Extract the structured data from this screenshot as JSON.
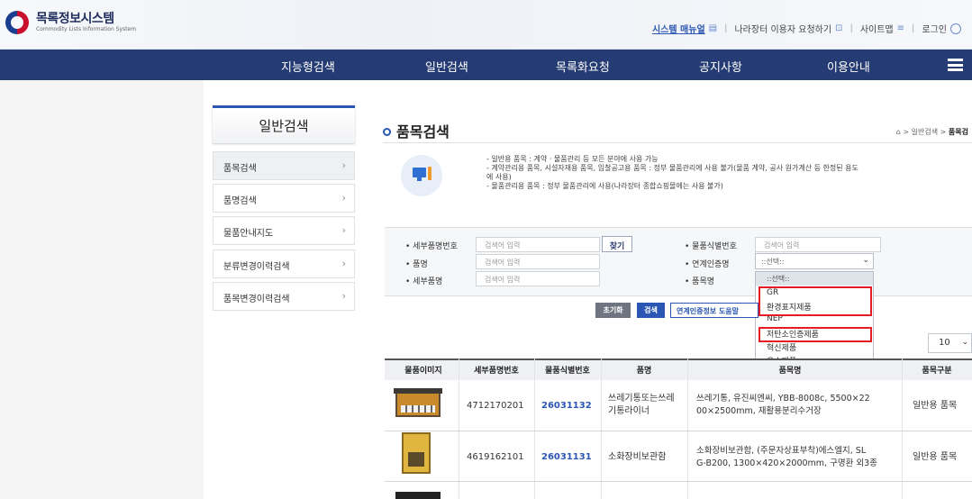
{
  "header": {
    "logo_title": "목록정보시스템",
    "logo_subtitle": "Commodity Lists Information System",
    "util_links": [
      "시스템 매뉴얼",
      "나라장터 이용자 요청하기",
      "사이트맵",
      "로그인"
    ]
  },
  "nav": [
    "지능형검색",
    "일반검색",
    "목록화요청",
    "공지사항",
    "이용안내"
  ],
  "sidebar": {
    "title": "일반검색",
    "items": [
      "품목검색",
      "품명검색",
      "물품안내지도",
      "분류변경이력검색",
      "품목변경이력검색"
    ]
  },
  "main": {
    "title": "품목검색",
    "breadcrumb": [
      "일반검색",
      "품목검"
    ],
    "info_lines": [
      "- 일반용 품목 : 계약 · 물품관리 등 모든 분야에 사용 가능",
      "- 계약관리용 품목, 시설자재용 품목, 입찰공고용 품목 : 정부 물품관리에 사용 불가(물품 계약, 공사 원가계산 등 한정된 용도",
      "에 사용)",
      "- 물품관리용 품목 : 정부 물품관리에 사용(나라장터 종합쇼핑몰에는 사용 불가)"
    ]
  },
  "form": {
    "labels": [
      "세부품명번호",
      "품명",
      "세부품명",
      "물품식별번호",
      "연계인증명",
      "품목명"
    ],
    "placeholder": "검색어 입력",
    "find_button": "찾기",
    "select_value": "::선택::",
    "dropdown_head": "::선택::",
    "dropdown_options": [
      "GR",
      "환경표지제품",
      "NEP",
      "저탄소인증제품",
      "혁신제품",
      "우수제품"
    ]
  },
  "buttons": {
    "reset": "초기화",
    "search": "검색",
    "help": "연계인증정보 도움말"
  },
  "page_size": "10",
  "table": {
    "headers": [
      "물품이미지",
      "세부품명번호",
      "물품식별번호",
      "품명",
      "품목명",
      "품목구분"
    ],
    "rows": [
      {
        "detail_no": "4712170201",
        "item_id": "26031132",
        "name": [
          "쓰레기통또는쓰레",
          "기통라이너"
        ],
        "desc": [
          "쓰레기통, 유진씨엔씨, YBB-8008c, 5500×22",
          "00×2500mm, 재활용분리수거장"
        ],
        "type": "일반용 품목"
      },
      {
        "detail_no": "4619162101",
        "item_id": "26031131",
        "name": [
          "소화장비보관함"
        ],
        "desc": [
          "소화장비보관함, (주문자상표부착)에스엘지, SL",
          "G-B200, 1300×420×2000mm, 구명환 외3종"
        ],
        "type": "일반용 품목"
      }
    ]
  },
  "colors": {
    "nav": "#253b73",
    "accent": "#2b56b3",
    "highlight": "#e51c23"
  }
}
